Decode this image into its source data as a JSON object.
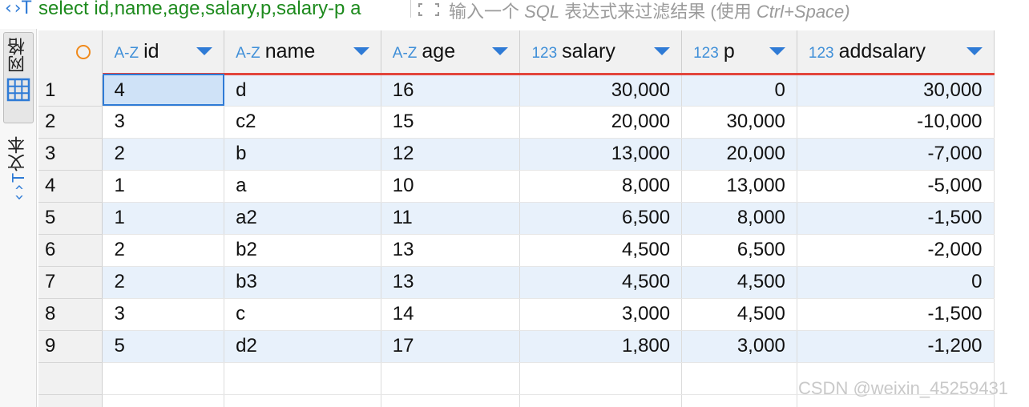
{
  "filter_bar": {
    "sql_icon": "‹›T",
    "sql_text": "select id,name,age,salary,p,salary-p a",
    "placeholder_cn": "输入一个 ",
    "placeholder_sql": "SQL",
    "placeholder_cn2": " 表达式来过滤结果 ",
    "placeholder_paren": "(使用 ",
    "placeholder_shortcut": "Ctrl+Space)"
  },
  "side_panel": {
    "grid_label": "网格",
    "text_label": "文本",
    "grid_icon": "grid-icon",
    "text_icon": "text-icon"
  },
  "table": {
    "columns": [
      {
        "type_tag": "A-Z",
        "name": "id",
        "align": "left"
      },
      {
        "type_tag": "A-Z",
        "name": "name",
        "align": "left"
      },
      {
        "type_tag": "A-Z",
        "name": "age",
        "align": "left"
      },
      {
        "type_tag": "123",
        "name": "salary",
        "align": "right"
      },
      {
        "type_tag": "123",
        "name": "p",
        "align": "right"
      },
      {
        "type_tag": "123",
        "name": "addsalary",
        "align": "right"
      }
    ],
    "rows": [
      {
        "n": "1",
        "id": "4",
        "name": "d",
        "age": "16",
        "salary": "30,000",
        "p": "0",
        "addsalary": "30,000"
      },
      {
        "n": "2",
        "id": "3",
        "name": "c2",
        "age": "15",
        "salary": "20,000",
        "p": "30,000",
        "addsalary": "-10,000"
      },
      {
        "n": "3",
        "id": "2",
        "name": "b",
        "age": "12",
        "salary": "13,000",
        "p": "20,000",
        "addsalary": "-7,000"
      },
      {
        "n": "4",
        "id": "1",
        "name": "a",
        "age": "10",
        "salary": "8,000",
        "p": "13,000",
        "addsalary": "-5,000"
      },
      {
        "n": "5",
        "id": "1",
        "name": "a2",
        "age": "11",
        "salary": "6,500",
        "p": "8,000",
        "addsalary": "-1,500"
      },
      {
        "n": "6",
        "id": "2",
        "name": "b2",
        "age": "13",
        "salary": "4,500",
        "p": "6,500",
        "addsalary": "-2,000"
      },
      {
        "n": "7",
        "id": "2",
        "name": "b3",
        "age": "13",
        "salary": "4,500",
        "p": "4,500",
        "addsalary": "0"
      },
      {
        "n": "8",
        "id": "3",
        "name": "c",
        "age": "14",
        "salary": "3,000",
        "p": "4,500",
        "addsalary": "-1,500"
      },
      {
        "n": "9",
        "id": "5",
        "name": "d2",
        "age": "17",
        "salary": "1,800",
        "p": "3,000",
        "addsalary": "-1,200"
      }
    ],
    "selected_cell": "row 1, id"
  },
  "watermark": "CSDN @weixin_45259431",
  "colors": {
    "sql_text": "#1d8a1d",
    "accent_blue": "#2f7bd6",
    "header_underline": "#e2453c",
    "row_stripe": "#e8f1fb",
    "rownum_circle": "#f08a1c"
  }
}
